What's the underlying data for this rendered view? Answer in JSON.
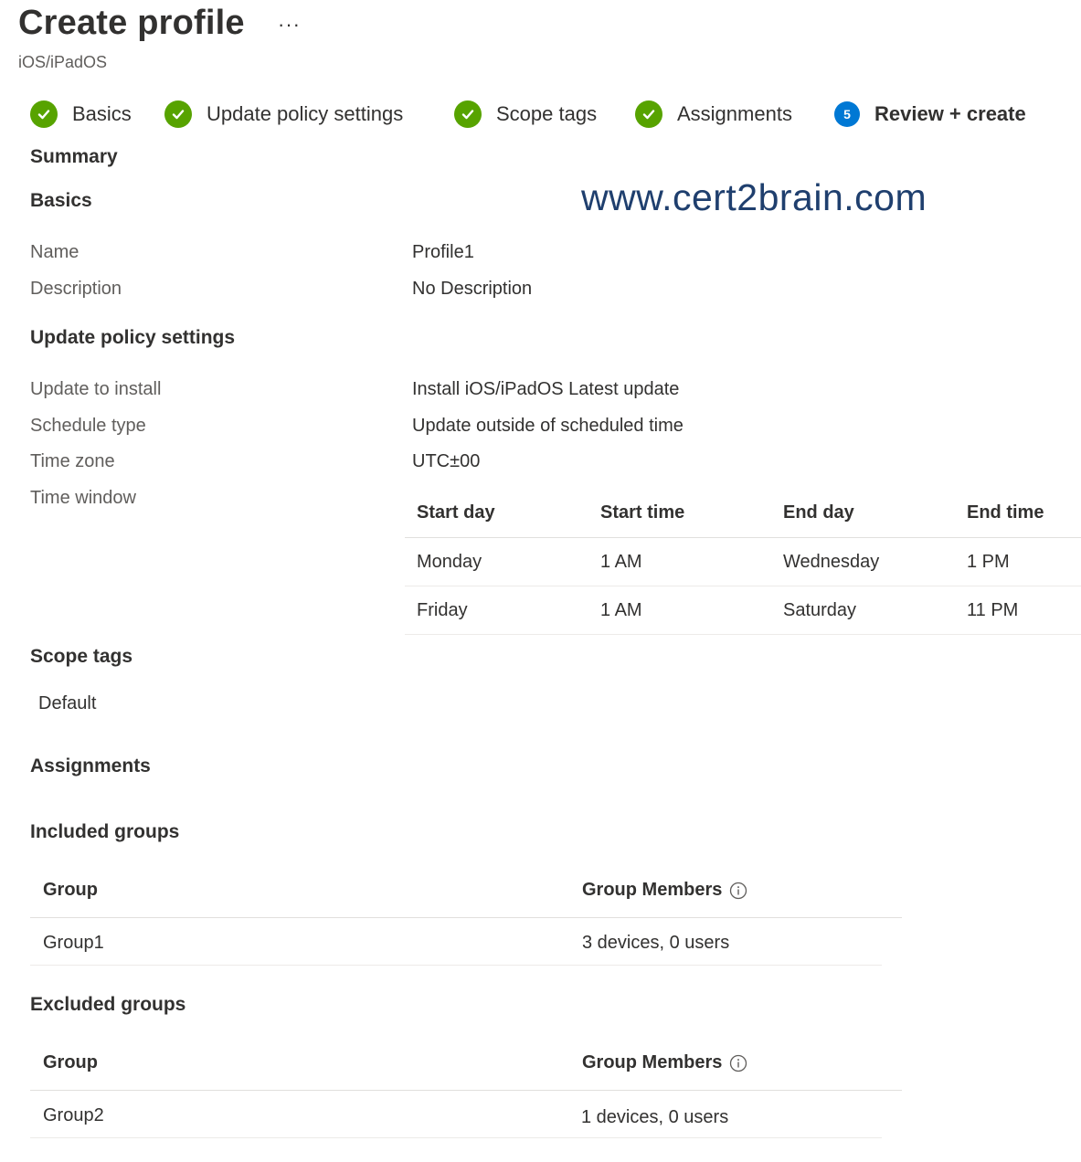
{
  "header": {
    "title": "Create profile",
    "more_label": "···",
    "subtitle": "iOS/iPadOS"
  },
  "wizard": {
    "steps": [
      {
        "label": "Basics",
        "status": "completed"
      },
      {
        "label": "Update policy settings",
        "status": "completed"
      },
      {
        "label": "Scope tags",
        "status": "completed"
      },
      {
        "label": "Assignments",
        "status": "completed"
      },
      {
        "label": "Review + create",
        "status": "current",
        "number": "5"
      }
    ]
  },
  "watermark": "www.cert2brain.com",
  "summary": {
    "heading": "Summary",
    "basics": {
      "heading": "Basics",
      "name_label": "Name",
      "name_value": "Profile1",
      "description_label": "Description",
      "description_value": "No Description"
    },
    "update_policy": {
      "heading": "Update policy settings",
      "update_to_install_label": "Update to install",
      "update_to_install_value": "Install iOS/iPadOS Latest update",
      "schedule_type_label": "Schedule type",
      "schedule_type_value": "Update outside of scheduled time",
      "time_zone_label": "Time zone",
      "time_zone_value": "UTC±00",
      "time_window_label": "Time window",
      "time_window_table": {
        "columns": [
          "Start day",
          "Start time",
          "End day",
          "End time"
        ],
        "rows": [
          [
            "Monday",
            "1 AM",
            "Wednesday",
            "1 PM"
          ],
          [
            "Friday",
            "1 AM",
            "Saturday",
            "11 PM"
          ]
        ]
      }
    },
    "scope_tags": {
      "heading": "Scope tags",
      "value": "Default"
    },
    "assignments": {
      "heading": "Assignments",
      "included": {
        "heading": "Included groups",
        "columns": [
          "Group",
          "Group Members"
        ],
        "rows": [
          [
            "Group1",
            "3 devices, 0 users"
          ]
        ]
      },
      "excluded": {
        "heading": "Excluded groups",
        "columns": [
          "Group",
          "Group Members"
        ],
        "rows": [
          [
            "Group2",
            "1 devices, 0 users"
          ]
        ]
      }
    }
  },
  "colors": {
    "step_completed": "#57a300",
    "step_current": "#0078d4",
    "watermark": "#1f3f6e",
    "label_gray": "#605e5c",
    "text": "#323130"
  }
}
